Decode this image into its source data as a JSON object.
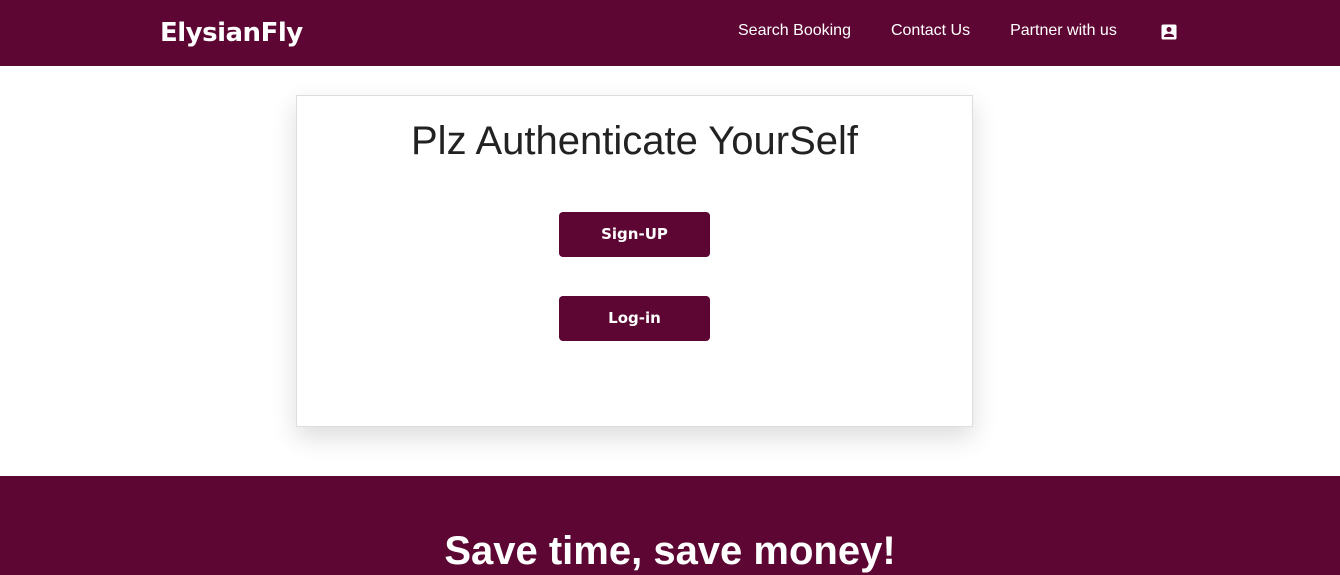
{
  "navbar": {
    "brand": "ElysianFly",
    "links": [
      {
        "label": "Search Booking"
      },
      {
        "label": "Contact Us"
      },
      {
        "label": "Partner with us"
      }
    ],
    "account_icon": "account-box-icon"
  },
  "auth": {
    "title": "Plz Authenticate YourSelf",
    "signup_label": "Sign-UP",
    "login_label": "Log-in"
  },
  "promo": {
    "title": "Save time, save money!"
  },
  "colors": {
    "brand": "#5d0633",
    "text_dark": "#222222",
    "white": "#ffffff"
  }
}
